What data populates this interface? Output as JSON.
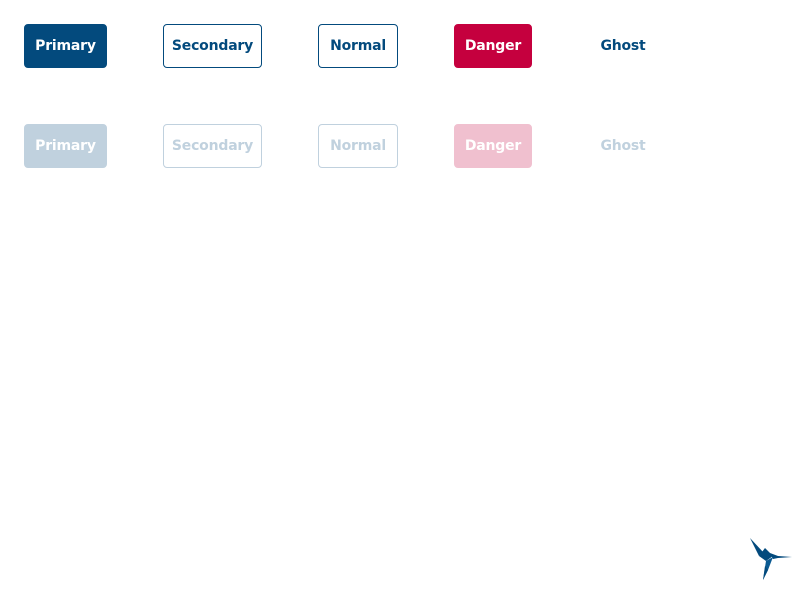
{
  "enabled_buttons": {
    "primary": "Primary",
    "secondary": "Secondary",
    "normal": "Normal",
    "danger": "Danger",
    "ghost": "Ghost"
  },
  "disabled_buttons": {
    "primary": "Primary",
    "secondary": "Secondary",
    "normal": "Normal",
    "danger": "Danger",
    "ghost": "Ghost"
  },
  "colors": {
    "primary": "#034a7d",
    "danger": "#c5003e",
    "primary_disabled": "#c0d1de",
    "danger_disabled": "#f0c0cf",
    "background": "#ffffff"
  },
  "logo": {
    "icon": "hummingbird-icon"
  }
}
